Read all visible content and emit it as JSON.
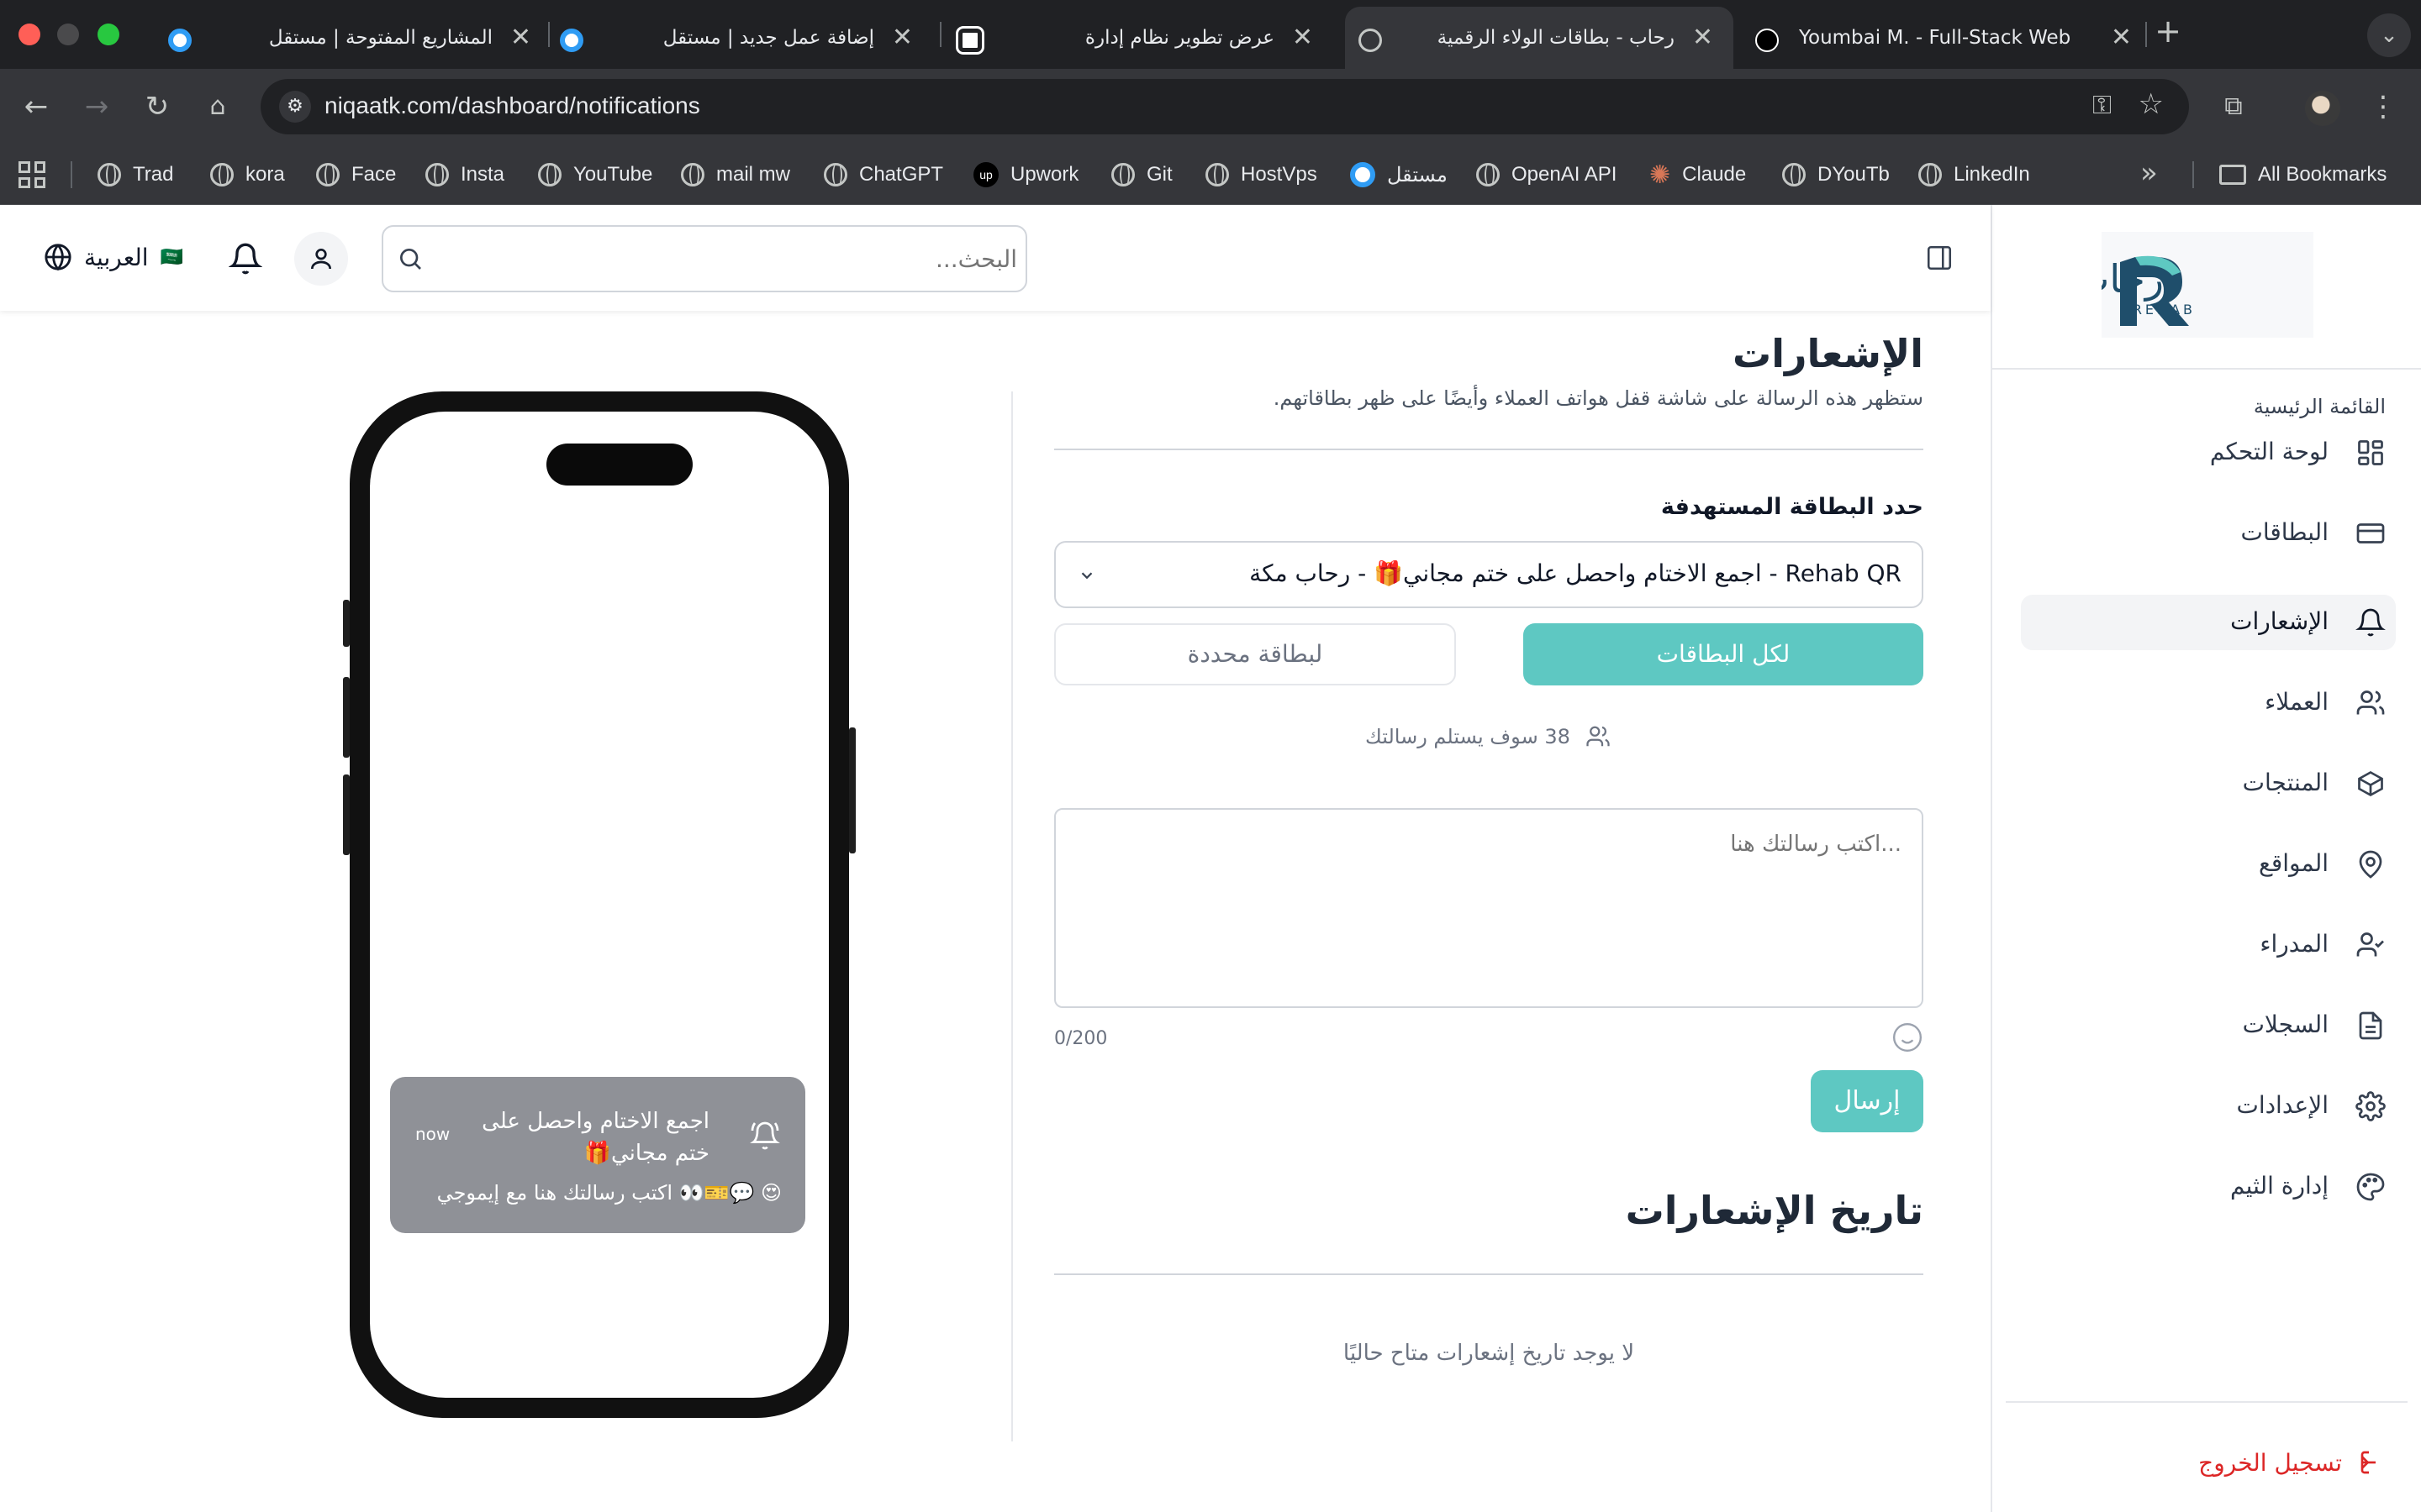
{
  "browser": {
    "tabs": [
      {
        "title": "المشاريع المفتوحة | مستقل",
        "active": false
      },
      {
        "title": "إضافة عمل جديد | مستقل",
        "active": false
      },
      {
        "title": "عرض تطوير نظام إدارة",
        "active": false
      },
      {
        "title": "رحاب - بطاقات الولاء الرقمية",
        "active": true
      },
      {
        "title": "Youmbai M. - Full-Stack Web",
        "active": false
      }
    ],
    "url": "niqaatk.com/dashboard/notifications",
    "bookmarks": [
      "Trad",
      "kora",
      "Face",
      "Insta",
      "YouTube",
      "mail mw",
      "ChatGPT",
      "Upwork",
      "Git",
      "HostVps",
      "مستقل",
      "OpenAI API",
      "Claude",
      "DYouTb",
      "LinkedIn"
    ],
    "all_bookmarks": "All Bookmarks"
  },
  "colors": {
    "accent": "#5ec8c2",
    "logo_blue": "#1f4e6b",
    "danger": "#dc2626"
  },
  "sidebar": {
    "logo_text": "رحاب",
    "logo_sub": "REHAB",
    "section_title": "القائمة الرئيسية",
    "items": [
      {
        "label": "لوحة التحكم",
        "icon": "dashboard-icon",
        "active": false
      },
      {
        "label": "البطاقات",
        "icon": "card-icon",
        "active": false
      },
      {
        "label": "الإشعارات",
        "icon": "bell-icon",
        "active": true
      },
      {
        "label": "العملاء",
        "icon": "users-icon",
        "active": false
      },
      {
        "label": "المنتجات",
        "icon": "box-icon",
        "active": false
      },
      {
        "label": "المواقع",
        "icon": "location-icon",
        "active": false
      },
      {
        "label": "المدراء",
        "icon": "user-check-icon",
        "active": false
      },
      {
        "label": "السجلات",
        "icon": "file-icon",
        "active": false
      },
      {
        "label": "الإعدادات",
        "icon": "gear-icon",
        "active": false
      },
      {
        "label": "إدارة الثيم",
        "icon": "palette-icon",
        "active": false
      }
    ],
    "logout": "تسجيل الخروج"
  },
  "header": {
    "search_placeholder": "البحث...",
    "language": "العربية",
    "flag": "🇸🇦"
  },
  "preview": {
    "notif_title": "اجمع الاختام واحصل على ختم مجاني🎁",
    "notif_body": "😍 💬🎫👀 اكتب رسالتك هنا مع إيموجي",
    "notif_time": "now"
  },
  "notifications": {
    "title": "الإشعارات",
    "subtitle": "ستظهر هذه الرسالة على شاشة قفل هواتف العملاء وأيضًا على ظهر بطاقاتهم.",
    "target_label": "حدد البطاقة المستهدفة",
    "selected_card": "Rehab QR - اجمع الاختام واحصل على ختم مجاني🎁 - رحاب مكة",
    "all_cards_button": "لكل البطاقات",
    "specific_card_button": "لبطاقة محددة",
    "recipients_text": "38 سوف يستلم رسالتك",
    "message_placeholder": "...اكتب رسالتك هنا",
    "char_count": "0/200",
    "send_button": "إرسال",
    "history_title": "تاريخ الإشعارات",
    "no_history": "لا يوجد تاريخ إشعارات متاح حاليًا"
  }
}
